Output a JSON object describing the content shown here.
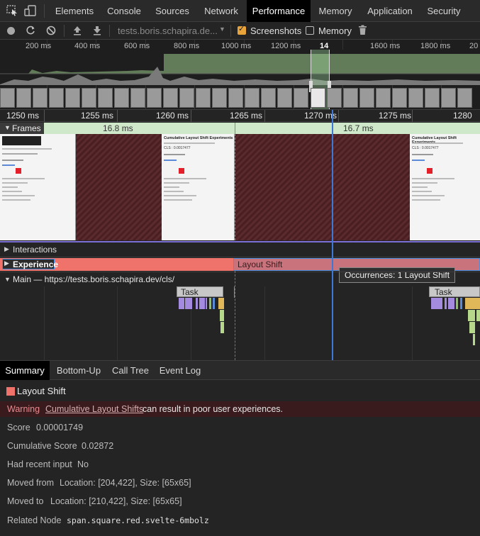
{
  "tabs": [
    {
      "label": "Elements"
    },
    {
      "label": "Console"
    },
    {
      "label": "Sources"
    },
    {
      "label": "Network"
    },
    {
      "label": "Performance"
    },
    {
      "label": "Memory"
    },
    {
      "label": "Application"
    },
    {
      "label": "Security"
    }
  ],
  "toolbar": {
    "url": "tests.boris.schapira.de...",
    "screenshots_label": "Screenshots",
    "screenshots_checked": true,
    "memory_label": "Memory",
    "memory_checked": false
  },
  "overview": {
    "ticks": [
      "200 ms",
      "400 ms",
      "600 ms",
      "800 ms",
      "1000 ms",
      "1200 ms",
      "14",
      "1600 ms",
      "1800 ms",
      "20"
    ]
  },
  "ruler": {
    "ticks": [
      "1250 ms",
      "1255 ms",
      "1260 ms",
      "1265 ms",
      "1270 ms",
      "1275 ms",
      "1280 m"
    ]
  },
  "frames": {
    "label": "Frames",
    "durations": [
      "16.8 ms",
      "16.7 ms"
    ],
    "thumbnail_title": "Cumulative Layout Shift Experiments",
    "thumbnail_cls": "CLS : 0.0017477"
  },
  "tracks": {
    "interactions_label": "Interactions",
    "experience_label": "Experience",
    "layout_shift_label": "Layout Shift",
    "tooltip": "Occurrences: 1 Layout Shift",
    "main_label": "Main — https://tests.boris.schapira.dev/cls/",
    "task_label": "Task"
  },
  "bottom_tabs": [
    {
      "label": "Summary"
    },
    {
      "label": "Bottom-Up"
    },
    {
      "label": "Call Tree"
    },
    {
      "label": "Event Log"
    }
  ],
  "summary": {
    "title": "Layout Shift",
    "swatch_color": "#f0736b",
    "warning_label": "Warning",
    "warning_link": "Cumulative Layout Shifts",
    "warning_text": "can result in poor user experiences.",
    "score_label": "Score",
    "score_value": "0.00001749",
    "cumulative_label": "Cumulative Score",
    "cumulative_value": "0.02872",
    "recent_input_label": "Had recent input",
    "recent_input_value": "No",
    "moved_from_label": "Moved from",
    "moved_from_value": "Location: [204,422], Size: [65x65]",
    "moved_to_label": "Moved to",
    "moved_to_value": "Location: [210,422], Size: [65x65]",
    "related_node_label": "Related Node",
    "related_node_value": "span.square.red.svelte-6mbolz"
  },
  "colors": {
    "experience_bar": "#f0736b",
    "layout_shift_bar": "#c9747c",
    "frames_header": "#cfe8c9",
    "warning_bg": "#3a1b1d",
    "accent_checkbox": "#e8a33a",
    "selection_line": "#3b78d8"
  }
}
